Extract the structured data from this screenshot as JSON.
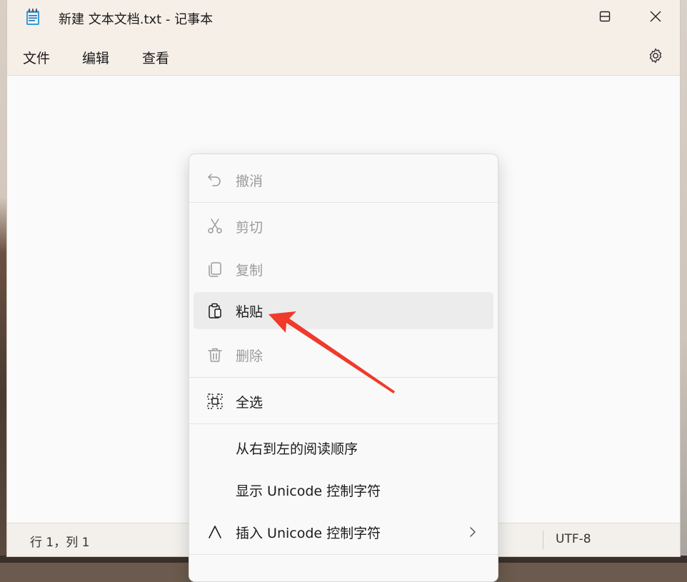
{
  "window": {
    "title": "新建 文本文档.txt - 记事本"
  },
  "menubar": {
    "items": [
      "文件",
      "编辑",
      "查看"
    ]
  },
  "statusbar": {
    "position": "行 1，列 1",
    "encoding": "UTF-8"
  },
  "context_menu": {
    "items": [
      {
        "label": "撤消",
        "icon": "undo-icon",
        "enabled": false
      },
      {
        "label": "剪切",
        "icon": "scissors-icon",
        "enabled": false
      },
      {
        "label": "复制",
        "icon": "copy-icon",
        "enabled": false
      },
      {
        "label": "粘贴",
        "icon": "clipboard-icon",
        "enabled": true
      },
      {
        "label": "删除",
        "icon": "trash-icon",
        "enabled": false
      },
      {
        "label": "全选",
        "icon": "select-all-icon",
        "enabled": true
      },
      {
        "label": "从右到左的阅读顺序",
        "icon": "",
        "enabled": true
      },
      {
        "label": "显示 Unicode 控制字符",
        "icon": "",
        "enabled": true
      },
      {
        "label": "插入 Unicode 控制字符",
        "icon": "insert-caret-icon",
        "enabled": true
      }
    ]
  },
  "colors": {
    "titlebar": "#f6efe8",
    "editor": "#fafafa",
    "annotation_arrow": "#f03a2a",
    "disabled_text": "#9b9b9b"
  }
}
